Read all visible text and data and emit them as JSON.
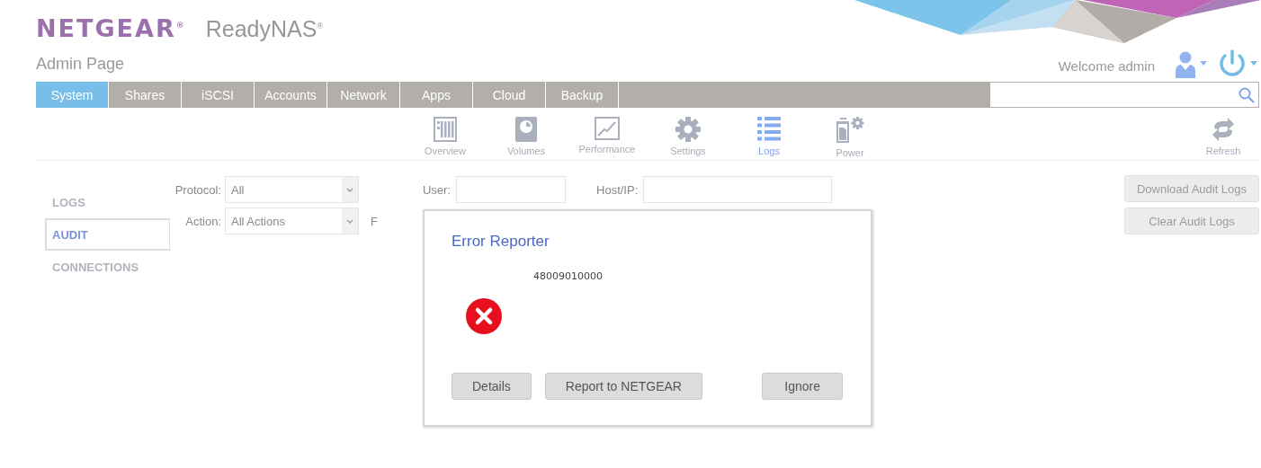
{
  "brand": {
    "logo": "NETGEAR$^{®}$",
    "product": "ReadyNAS$^{®}$",
    "subtitle": "Admin Page"
  },
  "user_bar": {
    "welcome": "Welcome admin"
  },
  "tabs": [
    {
      "label": "System",
      "selected": true
    },
    {
      "label": "Shares",
      "selected": false
    },
    {
      "label": "iSCSI",
      "selected": false
    },
    {
      "label": "Accounts",
      "selected": false
    },
    {
      "label": "Network",
      "selected": false
    },
    {
      "label": "Apps",
      "selected": false
    },
    {
      "label": "Cloud",
      "selected": false
    },
    {
      "label": "Backup",
      "selected": false
    }
  ],
  "toolbar": [
    {
      "kind": "overview",
      "label": "Overview",
      "selected": false
    },
    {
      "kind": "volumes",
      "label": "Volumes",
      "selected": false
    },
    {
      "kind": "performance",
      "label": "Performance",
      "selected": false
    },
    {
      "kind": "settings",
      "label": "Settings",
      "selected": false
    },
    {
      "kind": "logs",
      "label": "Logs",
      "selected": true
    },
    {
      "kind": "power",
      "label": "Power",
      "selected": false
    }
  ],
  "refresh": "Refresh",
  "side_menu": [
    {
      "label": "LOGS",
      "selected": false
    },
    {
      "label": "AUDIT",
      "selected": true
    },
    {
      "label": "CONNECTIONS",
      "selected": false
    }
  ],
  "filters": [
    {
      "label": "Protocol:",
      "value": "All"
    },
    {
      "label": "Action:",
      "value": "All Actions"
    }
  ],
  "covered_filters": {
    "user_label": "User:",
    "host_label": "Host/IP:",
    "cut_label": "F"
  },
  "actions": [
    {
      "label": "Download Audit Logs",
      "disabled": true
    },
    {
      "label": "Clear Audit Logs",
      "disabled": true
    }
  ],
  "dialog": {
    "title": "Error Reporter",
    "code": "48009010000",
    "buttons": [
      "Details",
      "Report to NETGEAR",
      "Ignore"
    ]
  }
}
